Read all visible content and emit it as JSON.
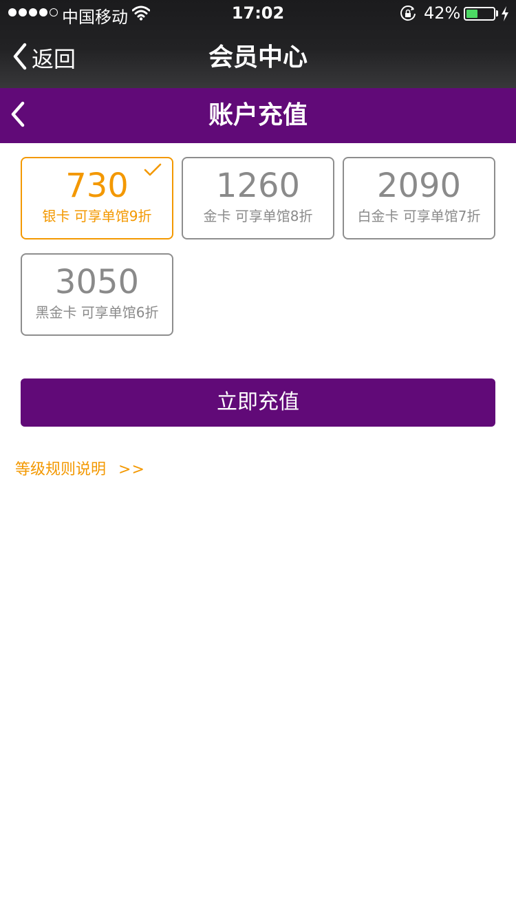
{
  "status_bar": {
    "carrier": "中国移动",
    "time": "17:02",
    "battery_percent": "42%",
    "battery_level": 0.42,
    "icons": [
      "signal-dots-icon",
      "wifi-icon",
      "orientation-lock-icon",
      "battery-icon",
      "charging-bolt-icon"
    ]
  },
  "nav": {
    "back_label": "返回",
    "title": "会员中心"
  },
  "page": {
    "title": "账户充值"
  },
  "cards": [
    {
      "amount": "730",
      "desc": "银卡  可享单馆9折",
      "selected": true
    },
    {
      "amount": "1260",
      "desc": "金卡  可享单馆8折",
      "selected": false
    },
    {
      "amount": "2090",
      "desc": "白金卡  可享单馆7折",
      "selected": false
    },
    {
      "amount": "3050",
      "desc": "黑金卡  可享单馆6折",
      "selected": false
    }
  ],
  "actions": {
    "recharge_label": "立即充值",
    "rules_label": "等级规则说明",
    "rules_arrow": ">>"
  },
  "colors": {
    "header_purple": "#610a78",
    "accent_orange": "#f39800",
    "card_gray": "#8a8a8a",
    "battery_green": "#4cd964"
  }
}
